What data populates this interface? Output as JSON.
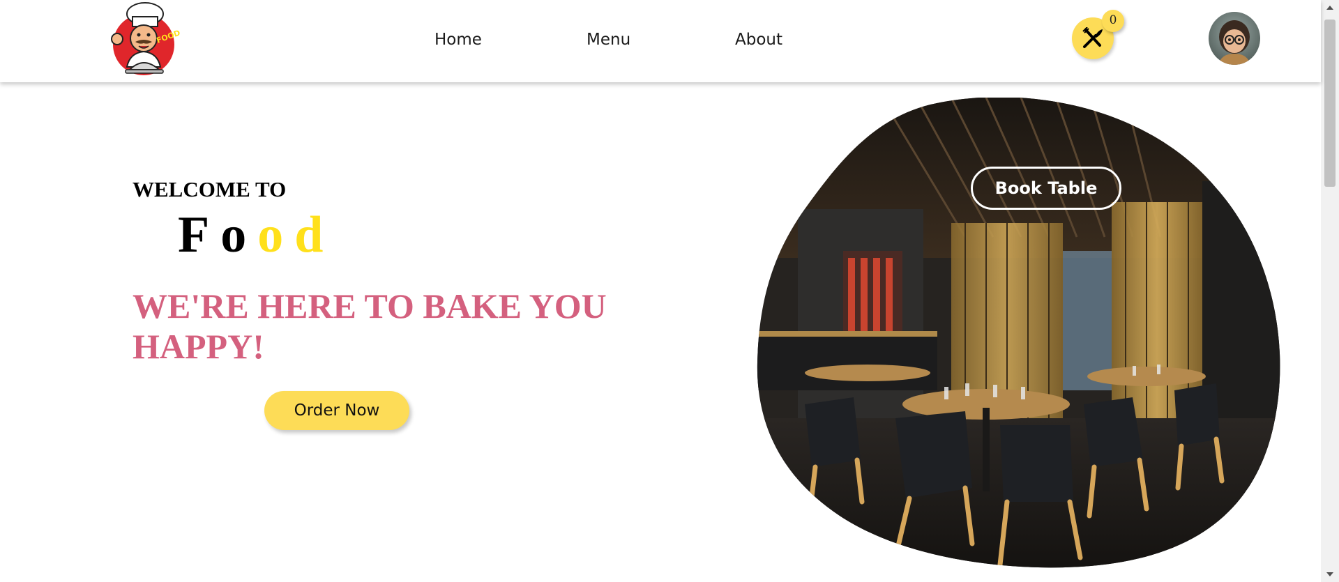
{
  "header": {
    "logo_text": "FOOD",
    "nav": [
      {
        "label": "Home"
      },
      {
        "label": "Menu"
      },
      {
        "label": "About"
      }
    ],
    "cart_count": "0",
    "cart_icon": "fork-knife-icon",
    "avatar_icon": "user-avatar"
  },
  "hero": {
    "welcome": "WELCOME TO",
    "brand_letters": [
      "F",
      "o",
      "o",
      "d"
    ],
    "tagline": "WE'RE HERE TO BAKE YOU HAPPY!",
    "order_button": "Order Now",
    "book_button": "Book Table"
  },
  "colors": {
    "accent_yellow": "#fddc57",
    "brand_yellow": "#ffe01b",
    "tagline_pink": "#d4607e"
  }
}
